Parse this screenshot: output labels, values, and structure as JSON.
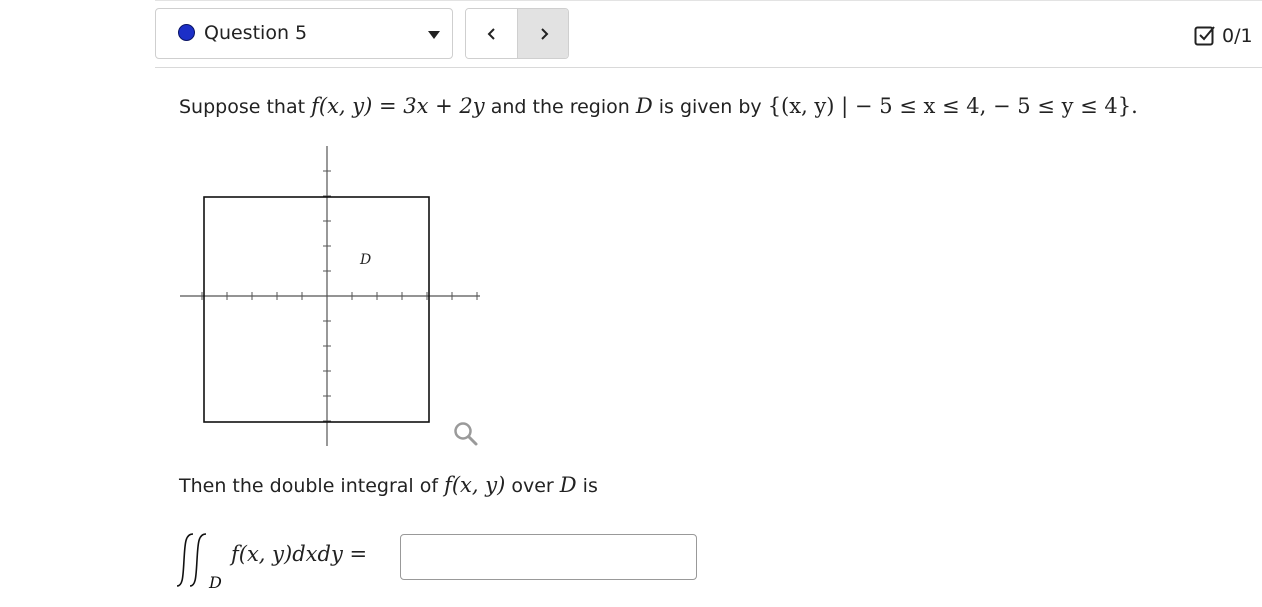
{
  "question_selector": {
    "label": "Question 5",
    "status_color": "#1c2fc7"
  },
  "nav": {
    "prev_icon": "chevron-left-icon",
    "next_icon": "chevron-right-icon"
  },
  "score": {
    "icon": "checkbox-check-icon",
    "text": "0/1"
  },
  "problem": {
    "prefix": "Suppose that",
    "function": "f(x, y) = 3x + 2y",
    "middle": "and the region",
    "region_name": "D",
    "suffix": "is given by",
    "region_set": "{(x, y) | − 5 ≤ x ≤ 4,  − 5 ≤ y ≤ 4}."
  },
  "graph": {
    "region_label": "D",
    "zoom_icon": "magnify-icon"
  },
  "prompt": {
    "prefix": "Then the double integral of",
    "function": "f(x, y)",
    "middle": "over",
    "region_name": "D",
    "suffix": "is"
  },
  "integral": {
    "integrand": "f(x, y)dxdy =",
    "subscript": "D"
  },
  "answer": {
    "value": ""
  }
}
